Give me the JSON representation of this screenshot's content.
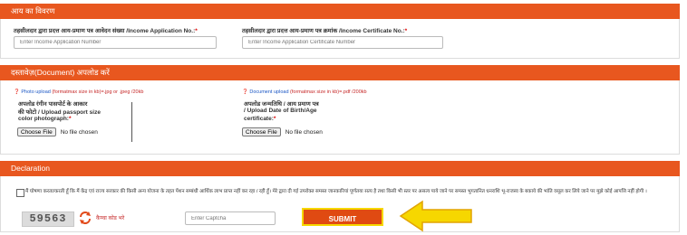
{
  "income_section": {
    "title": "आय का विवरण",
    "app_no_label": "तहसीलदार द्वारा प्रदत्त आय-प्रमाण पत्र आवेदन संख्या /Income Application No.:",
    "app_no_placeholder": "Enter Income Application Number",
    "cert_no_label": "तहसीलदार द्वारा प्रदत्त आय-प्रमाण पत्र क्रमांक /Income Certificate No.:",
    "cert_no_placeholder": "Enter Income Application Certificate Number",
    "required_mark": "*"
  },
  "document_section": {
    "title": "दस्तावेज़(Document) अपलोड करें",
    "photo_hint_prefix": "Photo upload",
    "photo_hint_format": "(formatmax size in kb)=.jpg or .jpeg /20kb",
    "photo_label_1": "अपलोड रंगीन पासपोर्ट के आकार",
    "photo_label_2": "की फोटो / Upload passport size",
    "photo_label_3": "color photograph:",
    "doc_hint_prefix": "Document upload",
    "doc_hint_format": "(formatmax size in kb)=.pdf /200kb",
    "doc_label_1": "अपलोड जन्मतिथि / आय प्रमाण पत्र",
    "doc_label_2": "/ Upload Date of Birth/Age",
    "doc_label_3": "certificate:",
    "choose_file": "Choose File",
    "no_file": "No file chosen",
    "required_mark": "*"
  },
  "declaration_section": {
    "title": "Declaration",
    "text": "मैं घोषणा करता/करती हूँ कि मैं केंद्र एवं राज्य सरकार की किसी अन्य योजना के तहत पेंशन सम्बंधी आर्थिक लाभ प्राप्त नहीं कर रहा / रही हूँ। मेरे द्वारा दी गई उपरोक्त समस्त जानकारियां पूर्णतया सत्य है तथा किसी भी स्तर पर असत्य पाये जाने पर समस्त भुगतानित धनराशि भू-राजस्व के बकाये की भांति वसूल कर लिये जाने पर मुझे कोई आपत्ति नहीं होगी ।",
    "captcha_text": "59563",
    "refresh_label": "कैप्चा कोड भरे",
    "captcha_placeholder": "Enter Captcha",
    "submit_label": "SUBMIT"
  },
  "colors": {
    "header": "#e8571f",
    "submit": "#e04a12",
    "submit_border": "#f6d700",
    "arrow": "#f6d700"
  }
}
